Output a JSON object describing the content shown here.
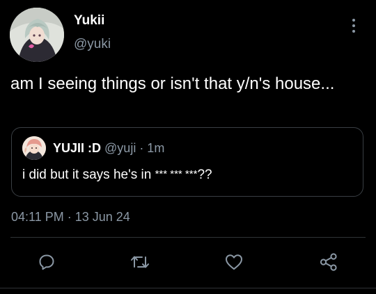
{
  "tweet": {
    "author": {
      "display_name": "Yukii",
      "handle": "@yuki"
    },
    "text": "am I seeing things or isn't that y/n's house...",
    "timestamp": "04:11 PM · 13 Jun 24"
  },
  "quoted_tweet": {
    "display_name": "YUJII :D",
    "meta": "@yuji · 1m",
    "text_prefix": "i did but it says he's in ",
    "redacted": "*** *** ***",
    "text_suffix": "??"
  },
  "actions": {
    "reply_icon": "reply-icon",
    "retweet_icon": "retweet-icon",
    "like_icon": "heart-icon",
    "share_icon": "share-icon"
  },
  "colors": {
    "background": "#000000",
    "primary_text": "#ffffff",
    "secondary_text": "#8b98a5",
    "border": "#3a3f44",
    "icon": "#8b98a5"
  }
}
